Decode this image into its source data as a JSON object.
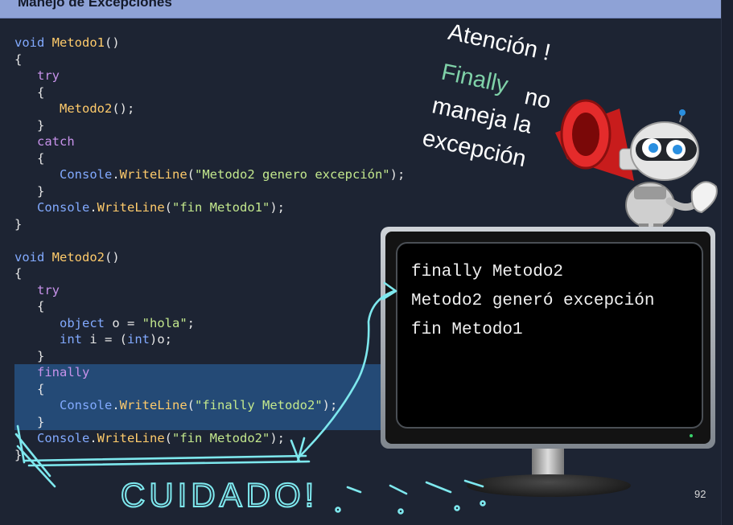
{
  "header": {
    "title": "Manejo de Excepciones"
  },
  "code": {
    "m1_sig_kw": "void",
    "m1_sig_fn": "Metodo1",
    "m1_sig_rest": "()",
    "m1_try": "try",
    "m1_call_fn": "Metodo2",
    "m1_call_rest": "();",
    "m1_catch": "catch",
    "console": "Console",
    "writeline": "WriteLine",
    "m1_str1": "\"Metodo2 genero excepción\"",
    "m1_str2": "\"fin Metodo1\"",
    "m2_sig_kw": "void",
    "m2_sig_fn": "Metodo2",
    "m2_sig_rest": "()",
    "m2_try": "try",
    "object_kw": "object",
    "obj_assign": " o = ",
    "hola_str": "\"hola\"",
    "int_kw": "int",
    "int_assign_a": " i = (",
    "int_kw2": "int",
    "int_assign_b": ")o;",
    "m2_finally": "finally",
    "m2_str1": "\"finally Metodo2\"",
    "m2_str2": "\"fin Metodo2\""
  },
  "note": {
    "line1": "Atención !",
    "line2a": "Finally",
    "line2b": "no",
    "line3": "maneja la",
    "line4": "excepción"
  },
  "console_output": [
    "finally Metodo2",
    "Metodo2 generó excepción",
    "fin Metodo1"
  ],
  "annotation": {
    "text": "CUIDADO!",
    "color": "#7ee8ee"
  },
  "slide": {
    "page_number": "92"
  },
  "colors": {
    "header_bg": "#8ea2d6",
    "editor_bg": "#1d2433",
    "highlight": "#244a76",
    "keyword": "#c792ea",
    "type": "#82aaff",
    "string": "#c3e88d",
    "function": "#ffcb6b"
  }
}
